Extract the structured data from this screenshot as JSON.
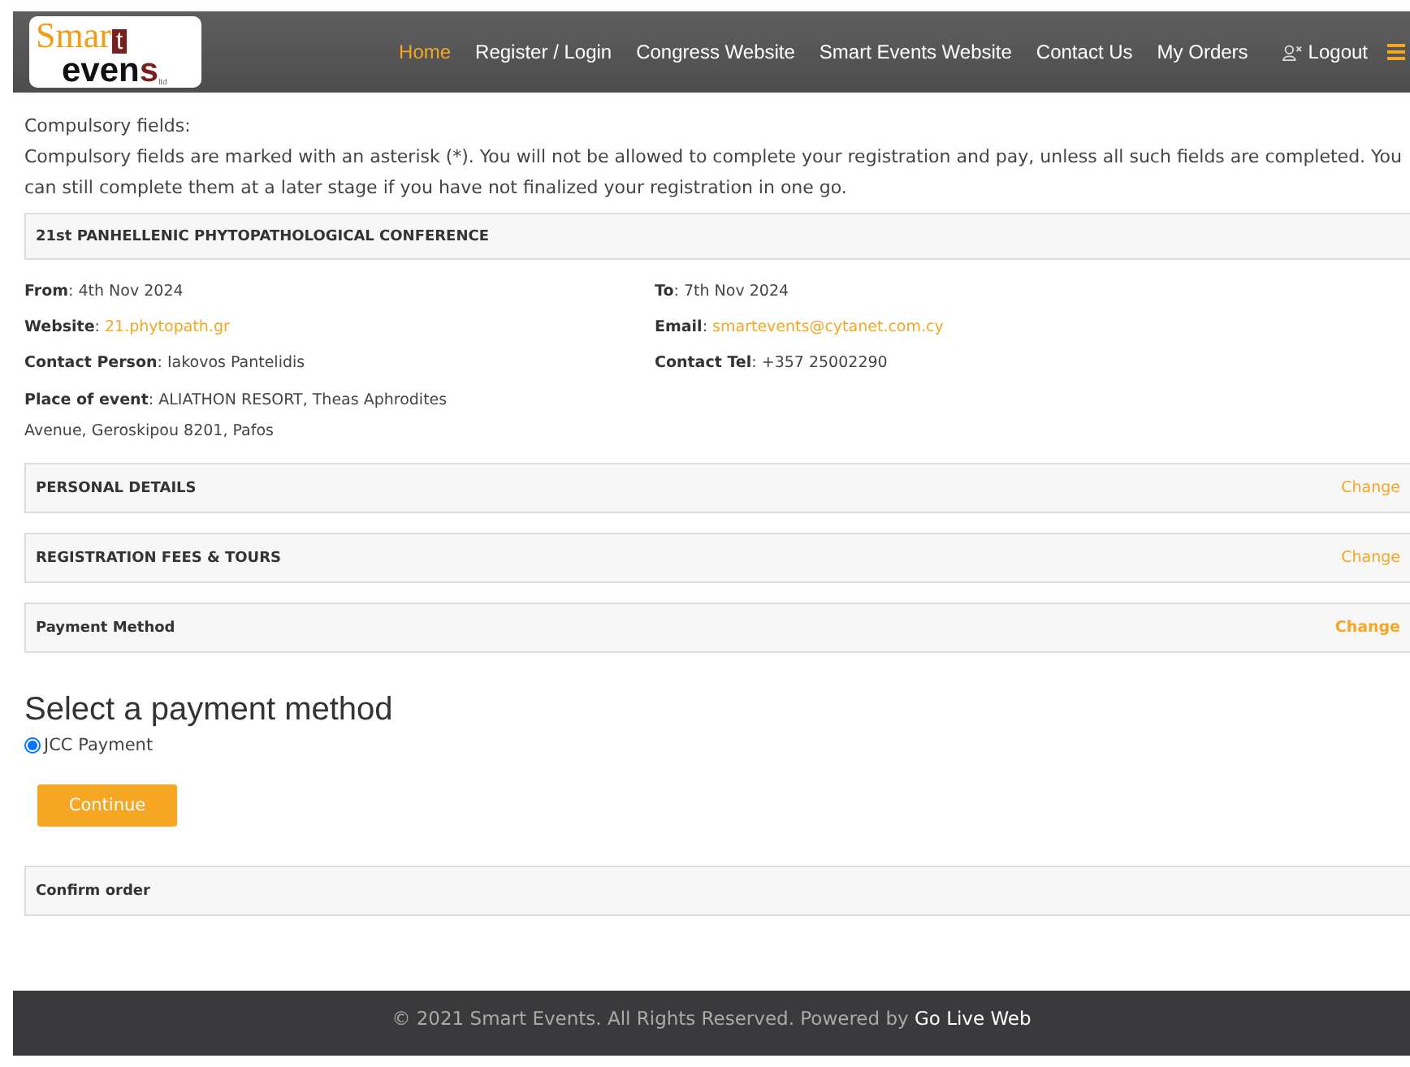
{
  "logo": {
    "top": "Smar",
    "top_box": "t",
    "bottom": "even",
    "bottom_tail": "s",
    "small": "ltd"
  },
  "nav": [
    {
      "label": "Home",
      "selected": true
    },
    {
      "label": "Register / Login",
      "selected": false
    },
    {
      "label": "Congress Website",
      "selected": false
    },
    {
      "label": "Smart Events Website",
      "selected": false
    },
    {
      "label": "Contact Us",
      "selected": false
    },
    {
      "label": "My Orders",
      "selected": false
    },
    {
      "label": "Logout",
      "selected": false,
      "kind": "logout"
    }
  ],
  "notice": {
    "title": "Compulsory fields:",
    "text": "Compulsory fields are marked with an asterisk (*). You will not be allowed to complete your registration and pay, unless all such fields are completed. You can still complete them at a later stage if you have not finalized your registration in one go."
  },
  "event": {
    "title": "21st PANHELLENIC PHYTOPATHOLOGICAL CONFERENCE",
    "left": [
      {
        "label": "**From**:",
        "value": "4th Nov 2024",
        "kind": "text"
      },
      {
        "label": "**Website**:",
        "value": "21.phytopath.gr",
        "kind": "link"
      },
      {
        "label": "**Contact Person**:",
        "value": "Iakovos Pantelidis",
        "kind": "text"
      },
      {
        "label": "**Place of event**:",
        "value": "ALIATHON RESORT, Theas Aphrodites Avenue, Geroskipou 8201, Pafos",
        "kind": "text"
      }
    ],
    "right": [
      {
        "label": "**To**:",
        "value": "7th Nov 2024",
        "kind": "text"
      },
      {
        "label": "**Email**:",
        "value": "smartevents@cytanet.com.cy",
        "kind": "link"
      },
      {
        "label": "**Contact Tel**:",
        "value": "+357 25002290",
        "kind": "text"
      }
    ]
  },
  "steps": [
    {
      "title": "PERSONAL DETAILS",
      "action": "Change",
      "current": false
    },
    {
      "title": "REGISTRATION FEES & TOURS",
      "action": "Change",
      "current": false
    },
    {
      "title": "Payment Method",
      "action": "Change",
      "current": true
    }
  ],
  "payment": {
    "heading": "Select a payment method",
    "options": [
      {
        "label": "JCC Payment",
        "selected": true
      }
    ],
    "button": "Continue"
  },
  "final_step": {
    "title": "Confirm order"
  },
  "footer": {
    "text": "© 2021 Smart Events. All Rights Reserved. Powered by",
    "link": "Go Live Web"
  }
}
